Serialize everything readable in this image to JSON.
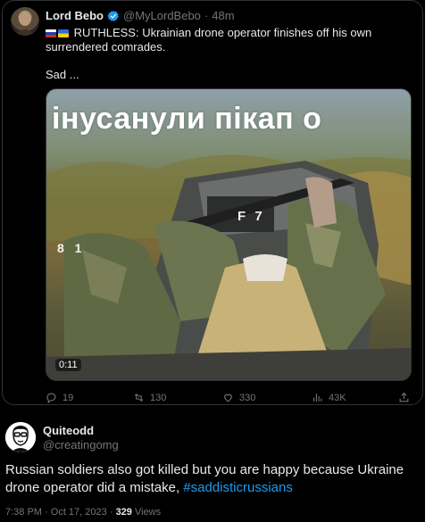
{
  "quoted_tweet": {
    "author_name": "Lord Bebo",
    "author_handle": "@MyLordBebo",
    "separator": "·",
    "time": "48m",
    "text": "RUTHLESS: Ukrainian drone operator finishes off his own surrendered comrades.",
    "text2": "Sad ...",
    "video": {
      "overlay_text": "інусанули пікап о",
      "duration": "0:11",
      "vehicle_marking": "F 7",
      "side_marking": "8 1"
    },
    "actions": {
      "replies": "19",
      "retweets": "130",
      "likes": "330",
      "views": "43K"
    }
  },
  "reply_tweet": {
    "author_name": "Quiteodd",
    "author_handle": "@creatingomg",
    "text": "Russian soldiers also got killed but you are happy because Ukraine drone operator did a mistake, ",
    "hashtag": "#saddisticrussians",
    "time": "7:38 PM",
    "date": "Oct 17, 2023",
    "dot": "·",
    "views_count": "329",
    "views_label": "Views"
  },
  "colors": {
    "background": "#000000",
    "text_primary": "#e7e9ea",
    "text_secondary": "#71767b",
    "accent": "#1d9bf0",
    "border": "#2f3336"
  },
  "icons": [
    "verified-badge-icon",
    "flag-russia-icon",
    "flag-ukraine-icon",
    "reply-icon",
    "retweet-icon",
    "like-icon",
    "views-icon"
  ]
}
